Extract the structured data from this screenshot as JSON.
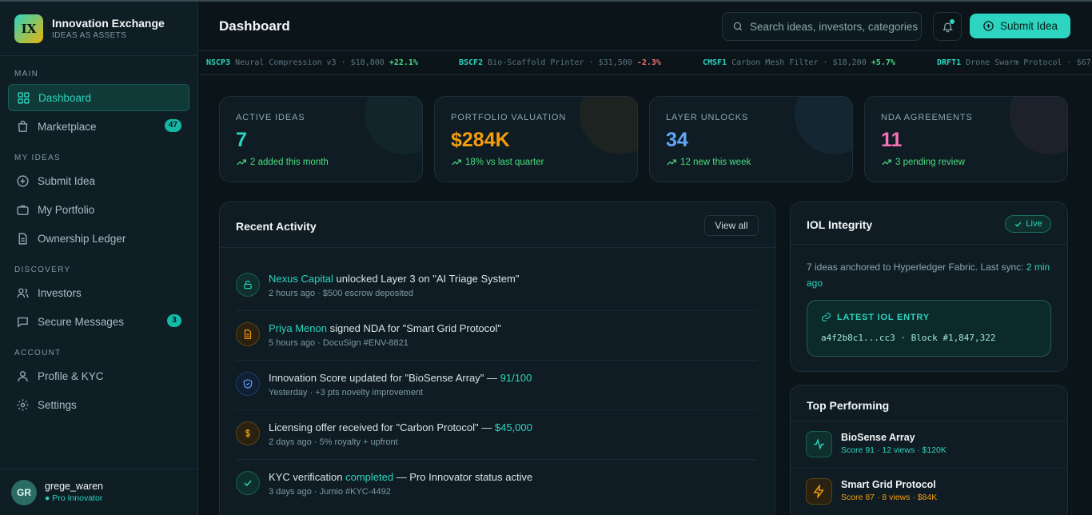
{
  "brand": {
    "logo": "IX",
    "name": "Innovation Exchange",
    "tagline": "IDEAS AS ASSETS"
  },
  "sidebar": {
    "sections": [
      "MAIN",
      "MY IDEAS",
      "DISCOVERY",
      "ACCOUNT"
    ],
    "items": [
      {
        "label": "Dashboard",
        "icon": "grid-icon",
        "active": true
      },
      {
        "label": "Marketplace",
        "icon": "shopping-bag-icon",
        "badge": "47"
      },
      {
        "label": "Submit Idea",
        "icon": "plus-circle-icon"
      },
      {
        "label": "My Portfolio",
        "icon": "briefcase-icon"
      },
      {
        "label": "Ownership Ledger",
        "icon": "document-icon"
      },
      {
        "label": "Investors",
        "icon": "users-icon"
      },
      {
        "label": "Secure Messages",
        "icon": "message-icon",
        "badge": "3"
      },
      {
        "label": "Profile & KYC",
        "icon": "user-icon"
      },
      {
        "label": "Settings",
        "icon": "gear-icon"
      }
    ]
  },
  "user": {
    "initials": "GR",
    "name": "grege_waren",
    "status": "● Pro Innovator"
  },
  "header": {
    "title": "Dashboard",
    "search_placeholder": "Search ideas, investors, categories",
    "submit_label": "Submit Idea"
  },
  "ticker": [
    {
      "symbol": "NSCP3",
      "name": "Neural Compression v3",
      "price": "$18,800",
      "change": "+22.1%",
      "direction": "up"
    },
    {
      "symbol": "BSCF2",
      "name": "Bio-Scaffold Printer",
      "price": "$31,500",
      "change": "-2.3%",
      "direction": "down"
    },
    {
      "symbol": "CMSF1",
      "name": "Carbon Mesh Filter",
      "price": "$18,200",
      "change": "+5.7%",
      "direction": "up"
    },
    {
      "symbol": "DRFT1",
      "name": "Drone Swarm Protocol",
      "price": "$67",
      "change": "",
      "direction": "up"
    }
  ],
  "stats": [
    {
      "label": "ACTIVE IDEAS",
      "value": "7",
      "sub": "2 added this month",
      "color": "#2dd4bf"
    },
    {
      "label": "PORTFOLIO VALUATION",
      "value": "$284K",
      "sub": "18% vs last quarter",
      "color": "#f59e0b"
    },
    {
      "label": "LAYER UNLOCKS",
      "value": "34",
      "sub": "12 new this week",
      "color": "#60a5fa"
    },
    {
      "label": "NDA AGREEMENTS",
      "value": "11",
      "sub": "3 pending review",
      "color": "#f472b6"
    }
  ],
  "activity": {
    "title": "Recent Activity",
    "view_all": "View all",
    "items": [
      {
        "hl": "Nexus Capital",
        "text": " unlocked Layer 3 on \"AI Triage System\"",
        "sub": "2 hours ago · $500 escrow deposited",
        "icon": "lock-icon"
      },
      {
        "hl": "Priya Menon",
        "text": " signed NDA for \"Smart Grid Protocol\"",
        "sub": "5 hours ago · DocuSign #ENV-8821",
        "icon": "file-icon"
      },
      {
        "text": "Innovation Score updated for \"BioSense Array\" — ",
        "hl": "91/100",
        "sub": "Yesterday · +3 pts novelty improvement",
        "icon": "shield-icon"
      },
      {
        "text": "Licensing offer received for \"Carbon Protocol\" — ",
        "hl": "$45,000",
        "sub": "2 days ago · 5% royalty + upfront",
        "icon": "dollar-icon"
      },
      {
        "text": "KYC verification ",
        "hl": "completed",
        "tail": " — Pro Innovator status active",
        "sub": "3 days ago · Jumio #KYC-4492",
        "icon": "check-icon"
      }
    ]
  },
  "iol": {
    "title": "IOL Integrity",
    "status": "Live",
    "desc_prefix": "7 ideas anchored to Hyperledger Fabric. Last sync: ",
    "desc_sync": "2 min ago",
    "entry_label": "LATEST IOL ENTRY",
    "entry_hash": "a4f2b8c1...cc3 · Block #1,847,322"
  },
  "top_performing": {
    "title": "Top Performing",
    "items": [
      {
        "name": "BioSense Array",
        "meta": "Score 91 · 12 views · $120K",
        "color": "#2dd4bf",
        "icon": "activity-icon"
      },
      {
        "name": "Smart Grid Protocol",
        "meta": "Score 87 · 8 views · $84K",
        "color": "#f59e0b",
        "icon": "zap-icon"
      }
    ]
  }
}
